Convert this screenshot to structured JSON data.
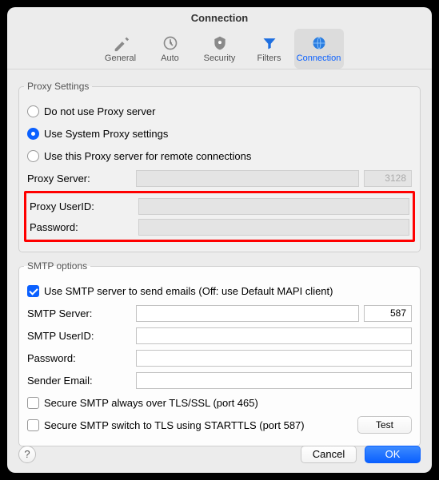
{
  "window": {
    "title": "Connection"
  },
  "tabs": {
    "general": {
      "label": "General"
    },
    "auto": {
      "label": "Auto"
    },
    "security": {
      "label": "Security"
    },
    "filters": {
      "label": "Filters"
    },
    "connection": {
      "label": "Connection"
    }
  },
  "proxy": {
    "legend": "Proxy Settings",
    "radio_none": "Do not use Proxy server",
    "radio_system": "Use System Proxy settings",
    "radio_remote": "Use this Proxy server for remote connections",
    "server_label": "Proxy Server:",
    "server_value": "",
    "port_value": "3128",
    "userid_label": "Proxy UserID:",
    "userid_value": "",
    "password_label": "Password:",
    "password_value": ""
  },
  "smtp": {
    "legend": "SMTP options",
    "use_smtp_label": "Use SMTP server to send emails (Off: use Default MAPI client)",
    "server_label": "SMTP Server:",
    "server_value": "",
    "port_value": "587",
    "userid_label": "SMTP UserID:",
    "userid_value": "",
    "password_label": "Password:",
    "password_value": "",
    "sender_label": "Sender Email:",
    "sender_value": "",
    "tls_465_label": "Secure SMTP always over TLS/SSL (port 465)",
    "tls_587_label": "Secure SMTP switch to TLS using STARTTLS (port 587)",
    "test_label": "Test"
  },
  "footer": {
    "help": "?",
    "cancel": "Cancel",
    "ok": "OK"
  }
}
